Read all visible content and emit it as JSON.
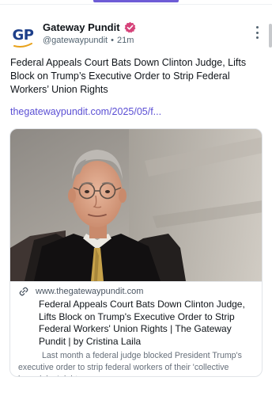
{
  "post": {
    "author_name": "Gateway Pundit",
    "avatar_text": "GP",
    "handle": "@gatewaypundit",
    "separator": "•",
    "time": "21m",
    "text": "Federal Appeals Court Bats Down Clinton Judge, Lifts Block on Trump’s Executive Order to Strip Federal Workers’ Union Rights",
    "link": "thegatewaypundit.com/2025/05/f..."
  },
  "card": {
    "domain": "www.thegatewaypundit.com",
    "title": "Federal Appeals Court Bats Down Clinton Judge, Lifts Block on Trump's Executive Order to Strip Federal Workers' Union Rights | The Gateway Pundit | by Cristina Laila",
    "description": "Last month a federal judge blocked President Trump's executive order to strip federal workers of their 'collective bargaining' rights."
  },
  "icons": {
    "verified": "verified-badge-icon",
    "more": "more-options-icon",
    "link": "link-icon"
  },
  "colors": {
    "accent": "#6e5cd6",
    "link": "#5b4fd4",
    "verified": "#d6437a",
    "brand": "#1d3f8a"
  }
}
